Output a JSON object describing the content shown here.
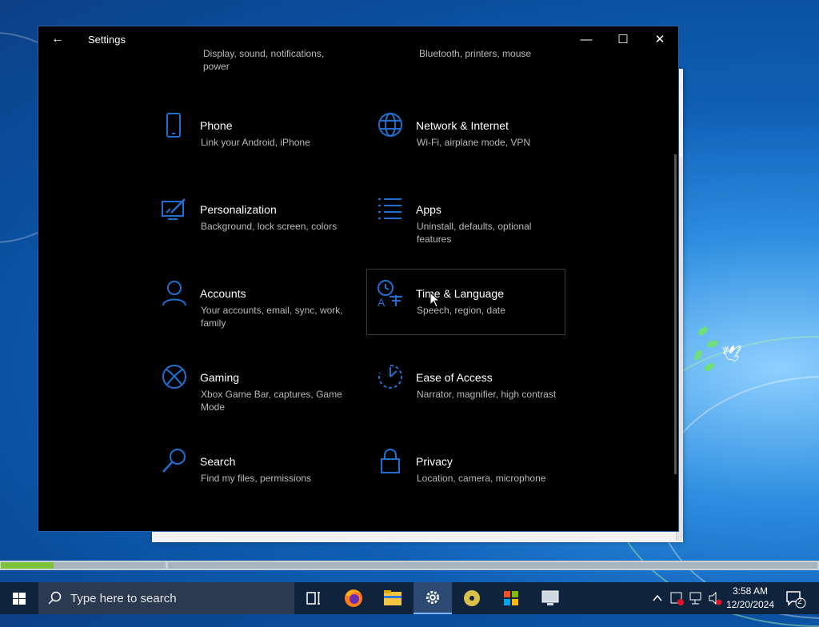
{
  "window": {
    "title": "Settings",
    "back_glyph": "←",
    "minimize_glyph": "—",
    "maximize_glyph": "☐",
    "close_glyph": "✕",
    "accent": "#1f6fd1"
  },
  "cut_off": {
    "left_line1": "Display, sound, notifications,",
    "left_line2": "power",
    "right_line1": "Bluetooth, printers, mouse"
  },
  "tiles": [
    {
      "name": "Phone",
      "desc": "Link your Android, iPhone",
      "icon": "phone-icon"
    },
    {
      "name": "Network & Internet",
      "desc": "Wi-Fi, airplane mode, VPN",
      "icon": "globe-icon"
    },
    {
      "name": "Personalization",
      "desc": "Background, lock screen, colors",
      "icon": "personalization-icon"
    },
    {
      "name": "Apps",
      "desc": "Uninstall, defaults, optional features",
      "icon": "apps-list-icon"
    },
    {
      "name": "Accounts",
      "desc": "Your accounts, email, sync, work, family",
      "icon": "person-icon"
    },
    {
      "name": "Time & Language",
      "desc": "Speech, region, date",
      "icon": "time-language-icon"
    },
    {
      "name": "Gaming",
      "desc": "Xbox Game Bar, captures, Game Mode",
      "icon": "xbox-icon"
    },
    {
      "name": "Ease of Access",
      "desc": "Narrator, magnifier, high contrast",
      "icon": "ease-of-access-icon"
    },
    {
      "name": "Search",
      "desc": "Find my files, permissions",
      "icon": "search-icon"
    },
    {
      "name": "Privacy",
      "desc": "Location, camera, microphone",
      "icon": "lock-icon"
    }
  ],
  "progress": {
    "fraction": 0.32,
    "color": "#7ec23a"
  },
  "taskbar": {
    "search_placeholder": "Type here to search",
    "time": "3:58 AM",
    "date": "12/20/2024",
    "notification_count": "2"
  }
}
